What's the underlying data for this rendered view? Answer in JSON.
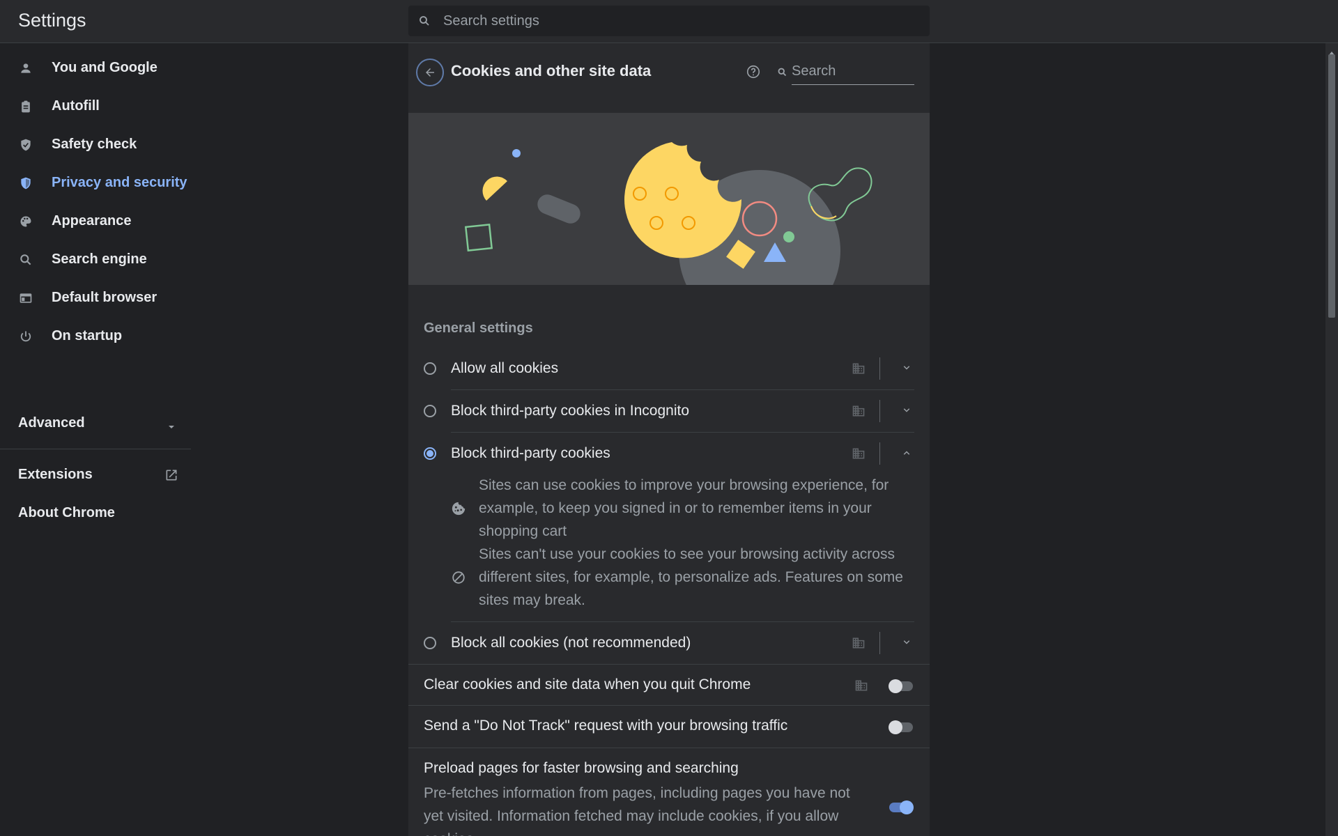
{
  "header": {
    "title": "Settings",
    "search_placeholder": "Search settings"
  },
  "sidebar": {
    "items": [
      {
        "label": "You and Google",
        "icon": "person-icon"
      },
      {
        "label": "Autofill",
        "icon": "clipboard-icon"
      },
      {
        "label": "Safety check",
        "icon": "shield-check-icon"
      },
      {
        "label": "Privacy and security",
        "icon": "shield-icon",
        "active": true
      },
      {
        "label": "Appearance",
        "icon": "palette-icon"
      },
      {
        "label": "Search engine",
        "icon": "search-icon"
      },
      {
        "label": "Default browser",
        "icon": "browser-icon"
      },
      {
        "label": "On startup",
        "icon": "power-icon"
      }
    ],
    "advanced_label": "Advanced",
    "extensions_label": "Extensions",
    "about_label": "About Chrome"
  },
  "page": {
    "title": "Cookies and other site data",
    "search_placeholder": "Search",
    "section_title": "General settings",
    "options": [
      {
        "label": "Allow all cookies",
        "selected": false,
        "expanded": false
      },
      {
        "label": "Block third-party cookies in Incognito",
        "selected": false,
        "expanded": false
      },
      {
        "label": "Block third-party cookies",
        "selected": true,
        "expanded": true
      },
      {
        "label": "Block all cookies (not recommended)",
        "selected": false,
        "expanded": false
      }
    ],
    "expanded_desc": {
      "allow_lines": [
        "Sites can use cookies to improve your browsing experience, for",
        "example, to keep you signed in or to remember items in your",
        "shopping cart"
      ],
      "block_lines": [
        "Sites can't use your cookies to see your browsing activity across",
        "different sites, for example, to personalize ads. Features on some",
        "sites may break."
      ]
    },
    "toggles": {
      "clear_on_quit": {
        "label": "Clear cookies and site data when you quit Chrome",
        "on": false
      },
      "do_not_track": {
        "label": "Send a \"Do Not Track\" request with your browsing traffic",
        "on": false
      },
      "preload": {
        "label": "Preload pages for faster browsing and searching",
        "desc_lines": [
          "Pre-fetches information from pages, including pages you have not",
          "yet visited. Information fetched may include cookies, if you allow",
          "cookies."
        ],
        "on": true
      }
    }
  },
  "colors": {
    "background": "#202124",
    "surface": "#292a2d",
    "accent": "#8ab4f8",
    "text_primary": "#e8eaed",
    "text_secondary": "#9aa0a6",
    "cookie": "#fdd663"
  }
}
